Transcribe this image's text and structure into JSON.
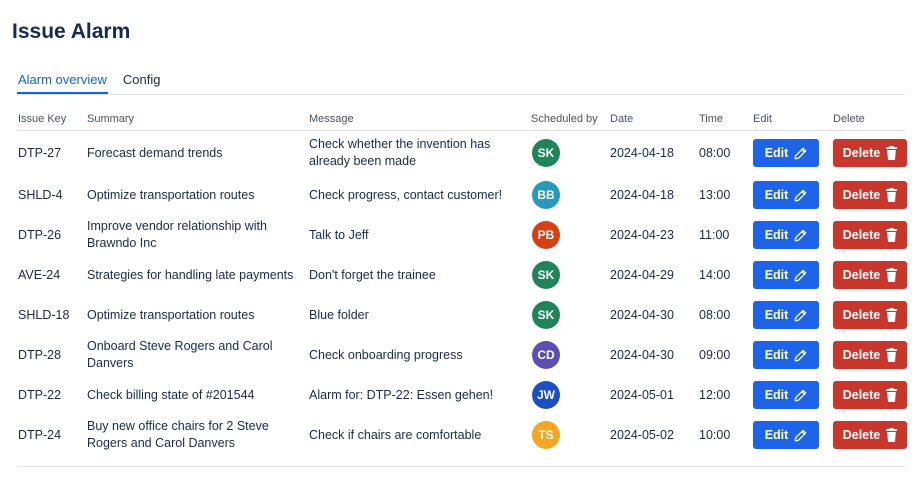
{
  "page": {
    "title": "Issue Alarm"
  },
  "tabs": [
    {
      "label": "Alarm overview",
      "active": true
    },
    {
      "label": "Config",
      "active": false
    }
  ],
  "table": {
    "headers": {
      "issue_key": "Issue Key",
      "summary": "Summary",
      "message": "Message",
      "scheduled_by": "Scheduled by",
      "date": "Date",
      "time": "Time",
      "edit": "Edit",
      "delete": "Delete"
    },
    "edit_label": "Edit",
    "delete_label": "Delete",
    "rows": [
      {
        "issue_key": "DTP-27",
        "summary": "Forecast demand trends",
        "message": "Check whether the invention has already been made",
        "initials": "SK",
        "avatar_color": "#1f845a",
        "date": "2024-04-18",
        "time": "08:00"
      },
      {
        "issue_key": "SHLD-4",
        "summary": "Optimize transportation routes",
        "message": "Check progress, contact customer!",
        "initials": "BB",
        "avatar_color": "#2898bd",
        "date": "2024-04-18",
        "time": "13:00"
      },
      {
        "issue_key": "DTP-26",
        "summary": "Improve vendor relationship with Brawndo Inc",
        "message": "Talk to Jeff",
        "initials": "PB",
        "avatar_color": "#d64114",
        "date": "2024-04-23",
        "time": "11:00"
      },
      {
        "issue_key": "AVE-24",
        "summary": "Strategies for handling late payments",
        "message": "Don't forget the trainee",
        "initials": "SK",
        "avatar_color": "#1f845a",
        "date": "2024-04-29",
        "time": "14:00"
      },
      {
        "issue_key": "SHLD-18",
        "summary": "Optimize transportation routes",
        "message": "Blue folder",
        "initials": "SK",
        "avatar_color": "#1f845a",
        "date": "2024-04-30",
        "time": "08:00"
      },
      {
        "issue_key": "DTP-28",
        "summary": "Onboard Steve Rogers and Carol Danvers",
        "message": "Check onboarding progress",
        "initials": "CD",
        "avatar_color": "#5e4db2",
        "date": "2024-04-30",
        "time": "09:00"
      },
      {
        "issue_key": "DTP-22",
        "summary": "Check billing state of #201544",
        "message": "Alarm for: DTP-22: Essen gehen!",
        "initials": "JW",
        "avatar_color": "#1d4fc4",
        "date": "2024-05-01",
        "time": "12:00"
      },
      {
        "issue_key": "DTP-24",
        "summary": "Buy new office chairs for 2 Steve Rogers and Carol Danvers",
        "message": "Check if chairs are comfortable",
        "initials": "TS",
        "avatar_color": "#f5a623",
        "date": "2024-05-02",
        "time": "10:00"
      }
    ]
  },
  "icons": {
    "edit": "pencil-icon",
    "delete": "trash-icon"
  }
}
